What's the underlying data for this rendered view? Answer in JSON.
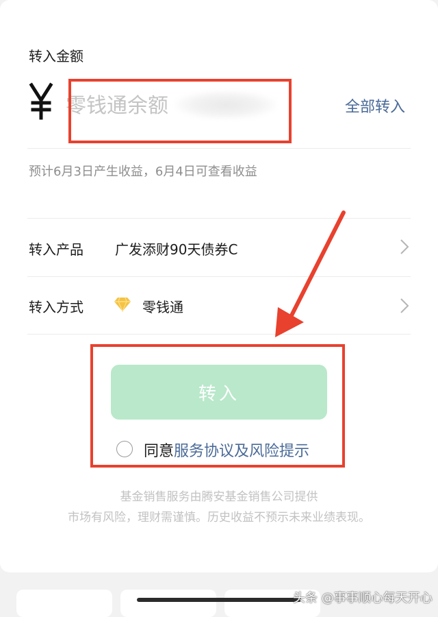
{
  "amount": {
    "label": "转入金额",
    "currency_symbol": "¥",
    "placeholder": "零钱通余额",
    "all_in_label": "全部转入"
  },
  "estimate_text": "预计6月3日产生收益，6月4日可查看收益",
  "rows": [
    {
      "label": "转入产品",
      "value": "广发添财90天债券C"
    },
    {
      "label": "转入方式",
      "value": "零钱通",
      "icon": "diamond-icon"
    }
  ],
  "submit_label": "转入",
  "agreement": {
    "prefix": "同意",
    "link_text": "服务协议及风险提示"
  },
  "footer": {
    "line1": "基金销售服务由腾安基金销售公司提供",
    "line2": "市场有风险，理财需谨慎。历史收益不预示未来业绩表现。"
  },
  "watermark": "头条 @事事顺心每天开心",
  "colors": {
    "accent_link": "#4a6a98",
    "button_disabled": "#b9e8cb",
    "annotation_red": "#e8412e",
    "diamond_gold": "#f5c242"
  }
}
